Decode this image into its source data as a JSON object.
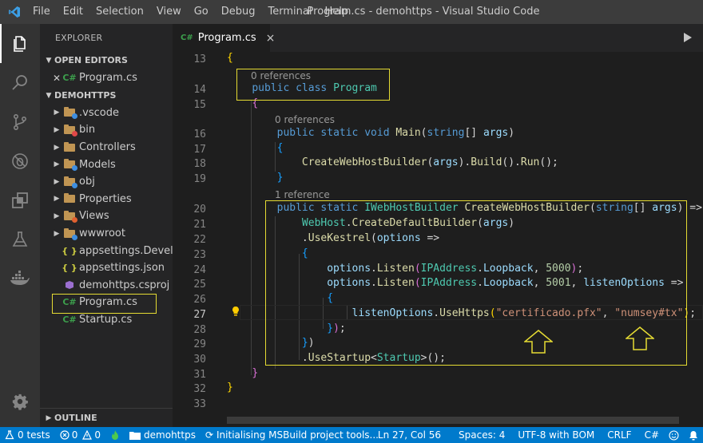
{
  "titlebar": {
    "menu": [
      "File",
      "Edit",
      "Selection",
      "View",
      "Go",
      "Debug",
      "Terminal",
      "Help"
    ],
    "title": "Program.cs - demohttps - Visual Studio Code"
  },
  "activity": [
    "files-icon",
    "search-icon",
    "source-control-icon",
    "debug-icon",
    "extensions-icon",
    "test-icon",
    "docker-icon"
  ],
  "sidebar": {
    "title": "EXPLORER",
    "open_editors_label": "OPEN EDITORS",
    "open_editor_icon": "C#",
    "open_editor_file": "Program.cs",
    "project_label": "DEMOHTTPS",
    "tree": [
      {
        "name": ".vscode",
        "type": "folder",
        "badge": "#3e8ee0"
      },
      {
        "name": "bin",
        "type": "folder",
        "badge": "#e04848"
      },
      {
        "name": "Controllers",
        "type": "folder",
        "badge": ""
      },
      {
        "name": "Models",
        "type": "folder",
        "badge": "#3e8ee0"
      },
      {
        "name": "obj",
        "type": "folder",
        "badge": "#3e8ee0"
      },
      {
        "name": "Properties",
        "type": "folder",
        "badge": ""
      },
      {
        "name": "Views",
        "type": "folder",
        "badge": "#e06030"
      },
      {
        "name": "wwwroot",
        "type": "folder",
        "badge": "#3e8ee0"
      },
      {
        "name": "appsettings.Devel...",
        "type": "json"
      },
      {
        "name": "appsettings.json",
        "type": "json"
      },
      {
        "name": "demohttps.csproj",
        "type": "proj"
      },
      {
        "name": "Program.cs",
        "type": "cs"
      },
      {
        "name": "Startup.cs",
        "type": "cs"
      }
    ],
    "outline_label": "OUTLINE"
  },
  "tab": {
    "icon": "C#",
    "label": "Program.cs",
    "close": "×"
  },
  "editor": {
    "line_numbers": [
      "13",
      "14",
      "15",
      "16",
      "17",
      "18",
      "19",
      "20",
      "21",
      "22",
      "23",
      "24",
      "25",
      "26",
      "27",
      "28",
      "29",
      "30",
      "31",
      "32",
      "33"
    ],
    "lens_0_refs": "0 references",
    "lens_0_refs_b": "0 references",
    "lens_1_ref": "1 reference",
    "str_cert": "\"certificado.pfx\"",
    "str_pass": "\"numsey#tx\"",
    "num_5000": "5000",
    "num_5001": "5001"
  },
  "status": {
    "tests": "0 tests",
    "errors": "0",
    "warnings": "0",
    "folder": "demohttps",
    "task": "Initialising MSBuild project tools...",
    "position": "Ln 27, Col 56",
    "spaces": "Spaces: 4",
    "encoding": "UTF-8 with BOM",
    "eol": "CRLF",
    "language": "C#"
  },
  "colors": {
    "accent": "#007acc",
    "highlight": "#e5db33"
  }
}
